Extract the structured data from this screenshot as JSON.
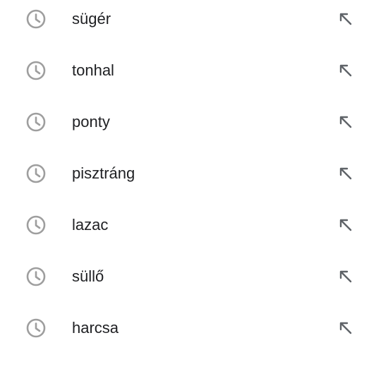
{
  "history": {
    "items": [
      {
        "label": "sügér",
        "icon": "history-clock-icon",
        "action_icon": "arrow-up-left-icon"
      },
      {
        "label": "tonhal",
        "icon": "history-clock-icon",
        "action_icon": "arrow-up-left-icon"
      },
      {
        "label": "ponty",
        "icon": "history-clock-icon",
        "action_icon": "arrow-up-left-icon"
      },
      {
        "label": "pisztráng",
        "icon": "history-clock-icon",
        "action_icon": "arrow-up-left-icon"
      },
      {
        "label": "lazac",
        "icon": "history-clock-icon",
        "action_icon": "arrow-up-left-icon"
      },
      {
        "label": "süllő",
        "icon": "history-clock-icon",
        "action_icon": "arrow-up-left-icon"
      },
      {
        "label": "harcsa",
        "icon": "history-clock-icon",
        "action_icon": "arrow-up-left-icon"
      }
    ]
  },
  "colors": {
    "text": "#202124",
    "icon": "#9e9e9e",
    "background": "#ffffff"
  }
}
